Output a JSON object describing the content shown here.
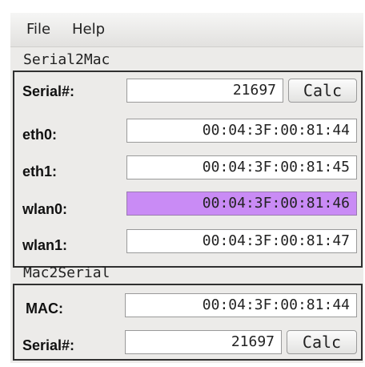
{
  "menubar": {
    "items": [
      "File",
      "Help"
    ]
  },
  "serial2mac": {
    "title": "Serial2Mac",
    "serial_label": "Serial#:",
    "serial_value": "21697",
    "calc_label": "Calc",
    "rows": [
      {
        "label": "eth0:",
        "value": "00:04:3F:00:81:44"
      },
      {
        "label": "eth1:",
        "value": "00:04:3F:00:81:45"
      },
      {
        "label": "wlan0:",
        "value": "00:04:3F:00:81:46"
      },
      {
        "label": "wlan1:",
        "value": "00:04:3F:00:81:47"
      }
    ],
    "highlight_color": "#c98bf5"
  },
  "mac2serial": {
    "title": "Mac2Serial",
    "mac_label": "MAC:",
    "mac_value": "00:04:3F:00:81:44",
    "serial_label": "Serial#:",
    "serial_value": "21697",
    "calc_label": "Calc"
  }
}
